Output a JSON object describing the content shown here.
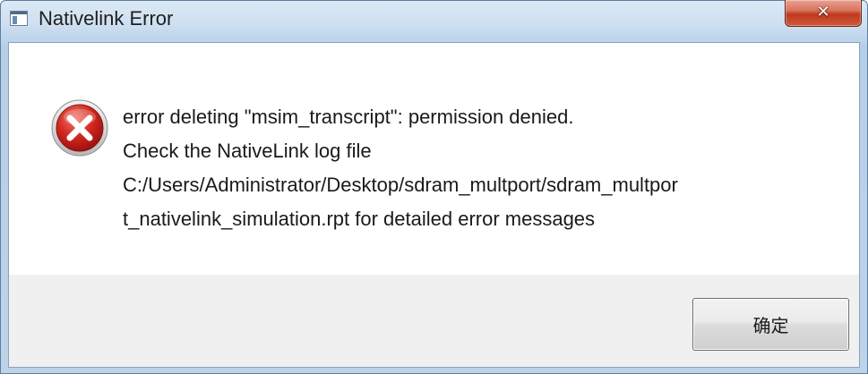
{
  "window": {
    "title": "Nativelink Error",
    "title_icon": "app-window-icon",
    "close_icon": "close-icon",
    "close_glyph": "✕"
  },
  "dialog": {
    "icon": "error-icon",
    "message_lines": [
      "error deleting \"msim_transcript\": permission denied.",
      "Check the NativeLink log file",
      "C:/Users/Administrator/Desktop/sdram_multport/sdram_multpor",
      "t_nativelink_simulation.rpt for detailed error messages"
    ],
    "ok_label": "确定"
  },
  "colors": {
    "error_red": "#c8201e",
    "close_red": "#c0391f",
    "frame_blue": "#bcd3ea"
  }
}
